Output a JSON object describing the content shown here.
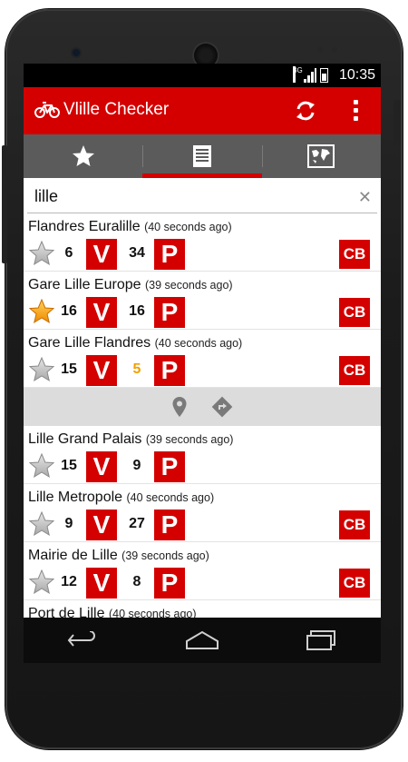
{
  "status_bar": {
    "network": "3G",
    "time": "10:35"
  },
  "app_bar": {
    "title": "Vlille Checker",
    "logo_icon": "bicycle-icon",
    "refresh_icon": "refresh-icon",
    "menu_icon": "overflow-menu-icon"
  },
  "tabs": [
    {
      "icon": "star-icon",
      "active": false
    },
    {
      "icon": "list-icon",
      "active": true
    },
    {
      "icon": "map-icon",
      "active": false
    }
  ],
  "search": {
    "value": "lille",
    "clear_icon": "close-icon"
  },
  "colors": {
    "accent": "#d40000",
    "tab_bar": "#5b5b5b",
    "warning": "#f0a000"
  },
  "stations": [
    {
      "name": "Flandres Euralille",
      "age": "(40 seconds ago)",
      "favorite": false,
      "bikes": "6",
      "bikes_badge": "V",
      "slots": "34",
      "slots_badge": "P",
      "cb": "CB"
    },
    {
      "name": "Gare Lille Europe",
      "age": "(39 seconds ago)",
      "favorite": true,
      "bikes": "16",
      "bikes_badge": "V",
      "slots": "16",
      "slots_badge": "P",
      "cb": "CB"
    },
    {
      "name": "Gare Lille Flandres",
      "age": "(40 seconds ago)",
      "favorite": false,
      "bikes": "15",
      "bikes_badge": "V",
      "slots": "5",
      "slots_low": true,
      "slots_badge": "P",
      "cb": "CB"
    },
    {
      "name": "Lille Grand Palais",
      "age": "(39 seconds ago)",
      "favorite": false,
      "bikes": "15",
      "bikes_badge": "V",
      "slots": "9",
      "slots_badge": "P",
      "cb": ""
    },
    {
      "name": "Lille Metropole",
      "age": "(40 seconds ago)",
      "favorite": false,
      "bikes": "9",
      "bikes_badge": "V",
      "slots": "27",
      "slots_badge": "P",
      "cb": "CB"
    },
    {
      "name": "Mairie de Lille",
      "age": "(39 seconds ago)",
      "favorite": false,
      "bikes": "12",
      "bikes_badge": "V",
      "slots": "8",
      "slots_badge": "P",
      "cb": "CB"
    },
    {
      "name": "Port de Lille",
      "age": "(40 seconds ago)"
    }
  ],
  "action_strip": {
    "location_icon": "map-pin-icon",
    "directions_icon": "directions-icon"
  },
  "nav_bar": {
    "back_icon": "back-icon",
    "home_icon": "home-icon",
    "recents_icon": "recents-icon"
  }
}
